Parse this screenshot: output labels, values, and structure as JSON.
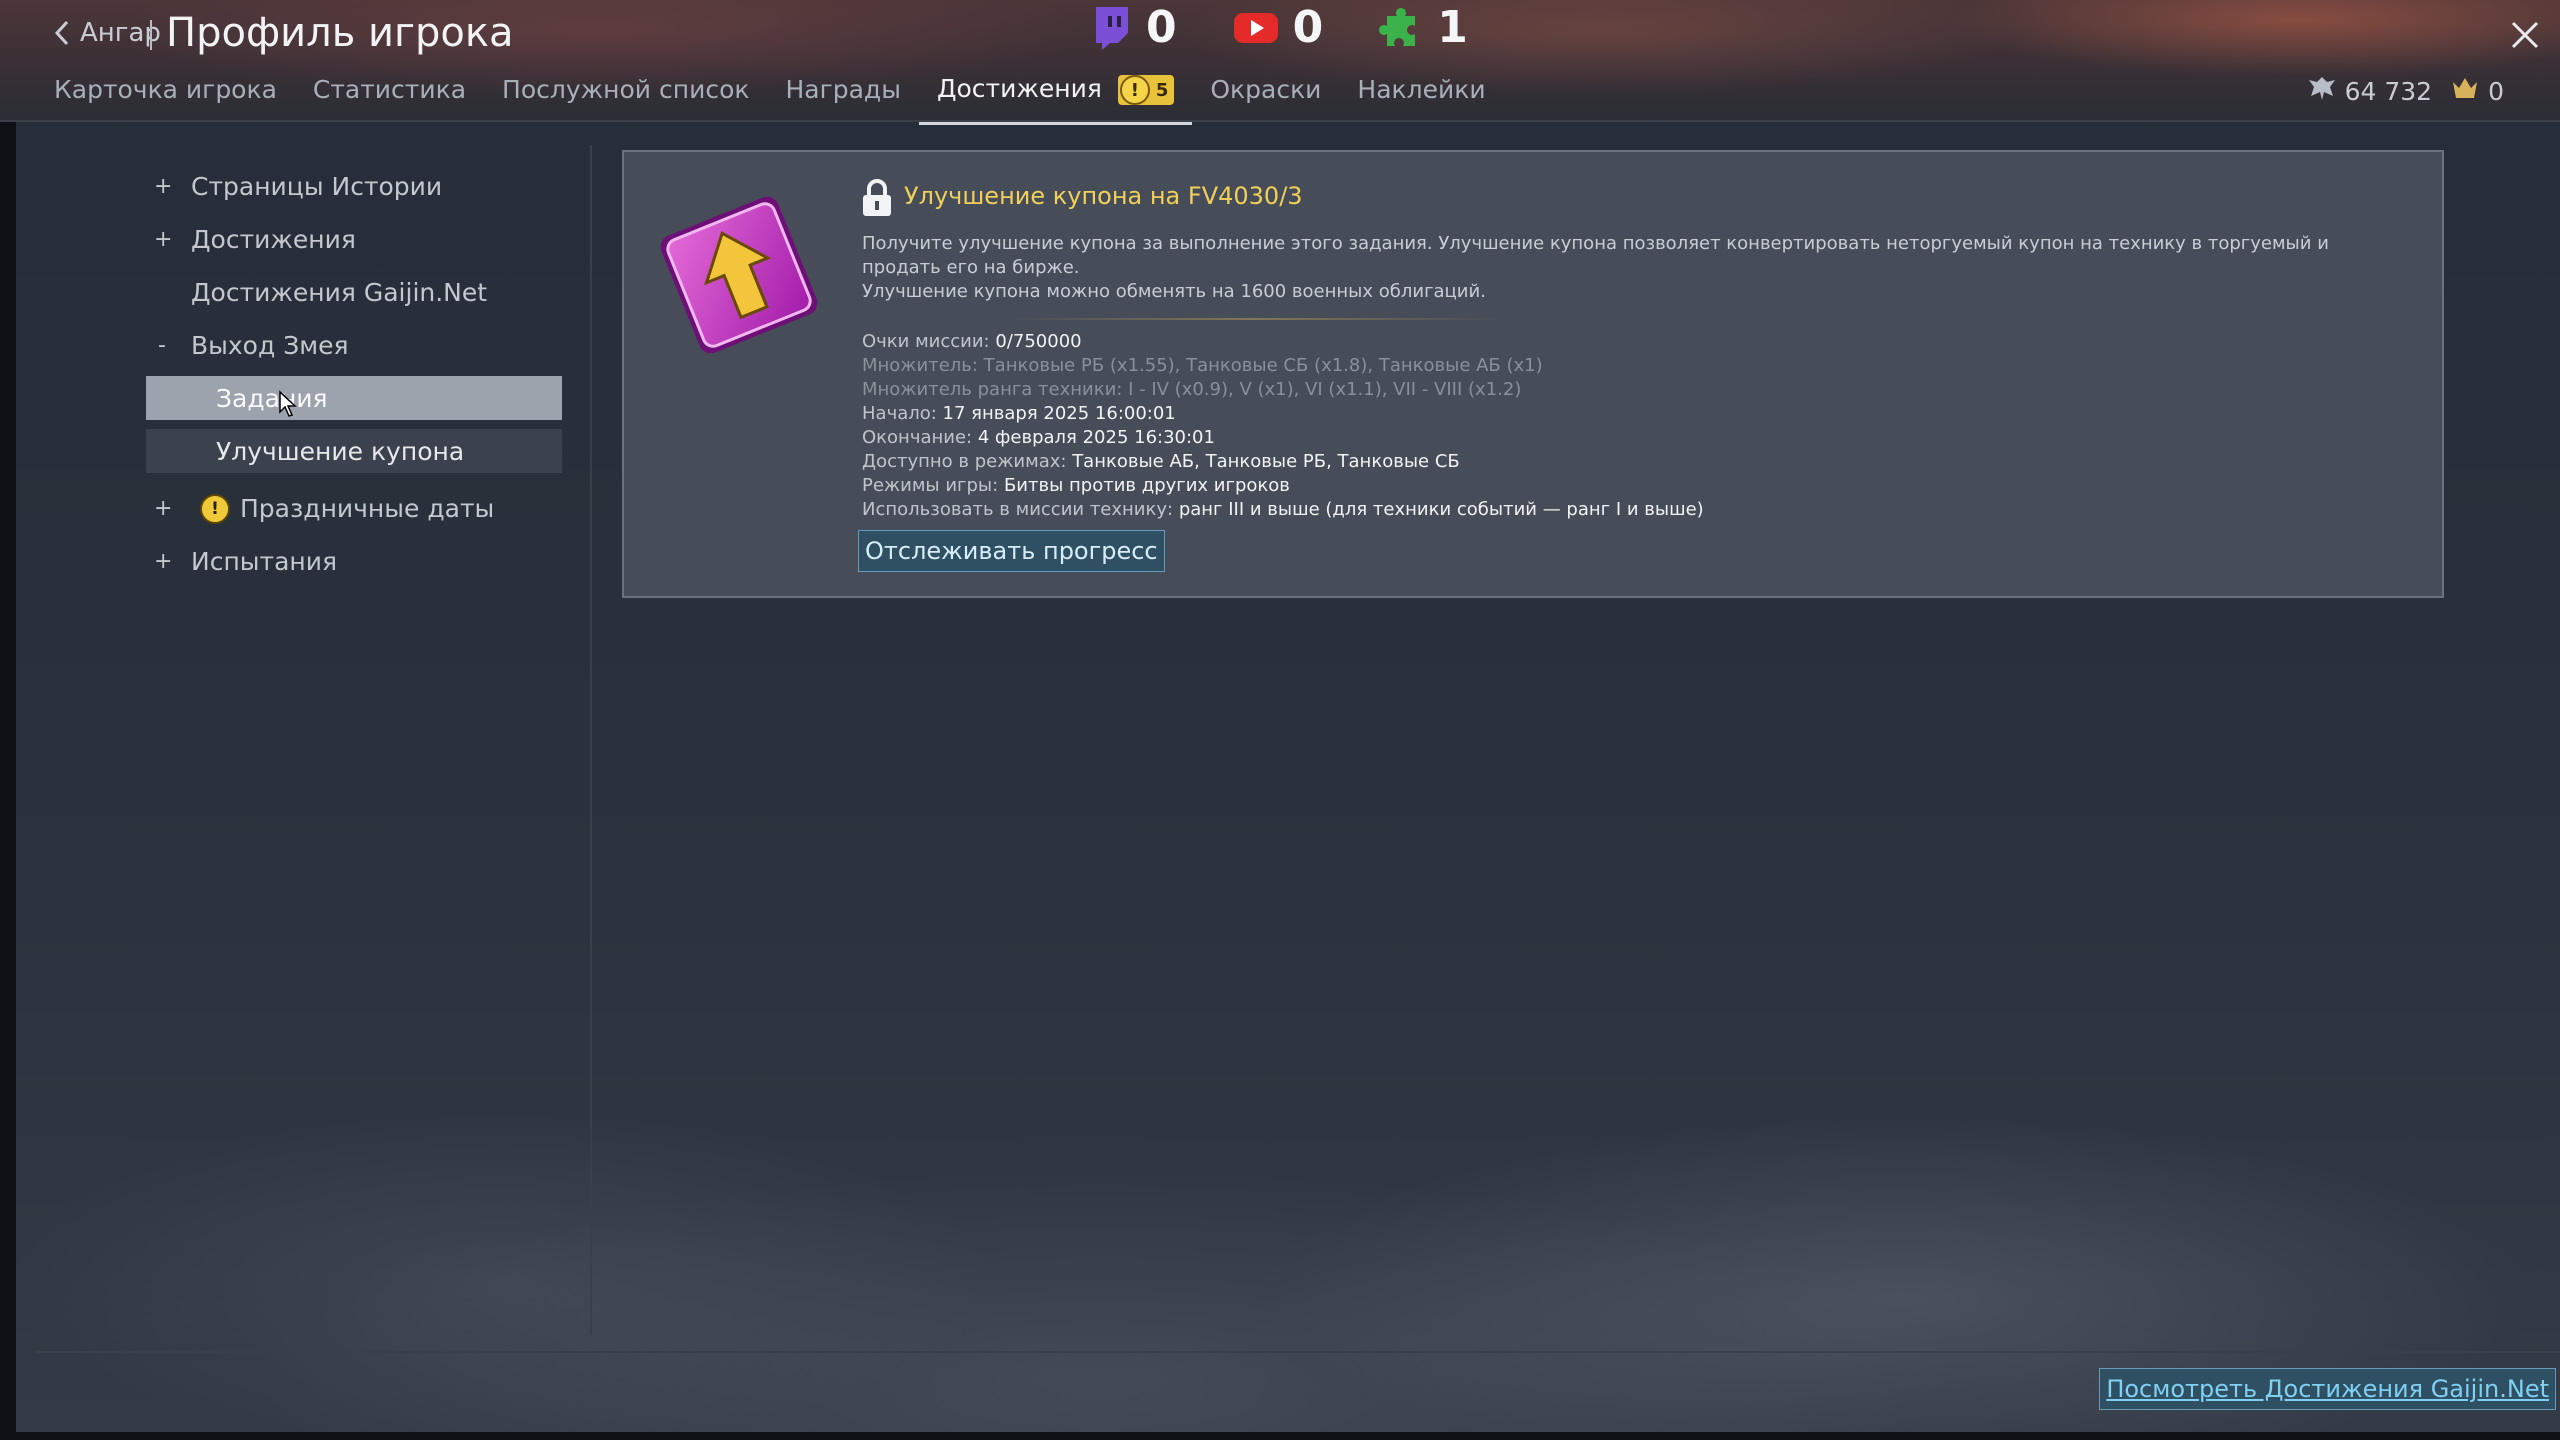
{
  "header": {
    "back_label": "Ангар",
    "title": "Профиль игрока",
    "counters": [
      {
        "icon": "twitch-icon",
        "value": "0",
        "color": "#7b4fd6"
      },
      {
        "icon": "youtube-icon",
        "value": "0",
        "color": "#e52a2a"
      },
      {
        "icon": "puzzle-icon",
        "value": "1",
        "color": "#3bb24a"
      }
    ]
  },
  "tabs": [
    {
      "label": "Карточка игрока"
    },
    {
      "label": "Статистика"
    },
    {
      "label": "Послужной список"
    },
    {
      "label": "Награды"
    },
    {
      "label": "Достижения",
      "badge": "5",
      "active": true
    },
    {
      "label": "Окраски"
    },
    {
      "label": "Наклейки"
    }
  ],
  "currency": {
    "eagles_icon": "eagle-icon",
    "eagles": "64 732",
    "crowns_icon": "crown-icon",
    "crowns": "0"
  },
  "sidebar": {
    "items": [
      {
        "toggle": "+",
        "label": "Страницы Истории"
      },
      {
        "toggle": "+",
        "label": "Достижения"
      },
      {
        "toggle": "",
        "label": "Достижения Gaijin.Net"
      },
      {
        "toggle": "-",
        "label": "Выход Змея"
      },
      {
        "toggle": "+",
        "label": "Праздничные даты"
      },
      {
        "toggle": "+",
        "label": "Испытания"
      }
    ],
    "subitems": [
      {
        "label": "Задания",
        "selected": true
      },
      {
        "label": "Улучшение купона",
        "selected": false
      }
    ]
  },
  "card": {
    "title": "Улучшение купона на FV4030/3",
    "desc_line1": "Получите улучшение купона за выполнение этого задания. Улучшение купона позволяет конвертировать неторгуемый купон на технику в торгуемый и продать его на бирже.",
    "desc_line2": "Улучшение купона можно обменять на 1600 военных облигаций.",
    "points_label": "Очки миссии:",
    "points_value": "0/750000",
    "multiplier1": "Множитель: Танковые РБ (x1.55), Танковые СБ (x1.8), Танковые АБ (x1)",
    "multiplier2": "Множитель ранга техники: I - IV (x0.9), V (x1), VI (x1.1), VII - VIII (x1.2)",
    "start_label": "Начало:",
    "start_value": "17 января 2025 16:00:01",
    "end_label": "Окончание:",
    "end_value": "4 февраля 2025 16:30:01",
    "modes_label": "Доступно в режимах:",
    "modes_value": "Танковые АБ, Танковые РБ, Танковые СБ",
    "game_modes_label": "Режимы игры:",
    "game_modes_value": "Битвы против других игроков",
    "vehicles_label": "Использовать в миссии технику:",
    "vehicles_value": "ранг III и выше (для техники событий — ранг I и выше)",
    "track_button": "Отслеживать прогресс"
  },
  "footer": {
    "gaijin_button": "Посмотреть Достижения Gaijin.Net"
  }
}
